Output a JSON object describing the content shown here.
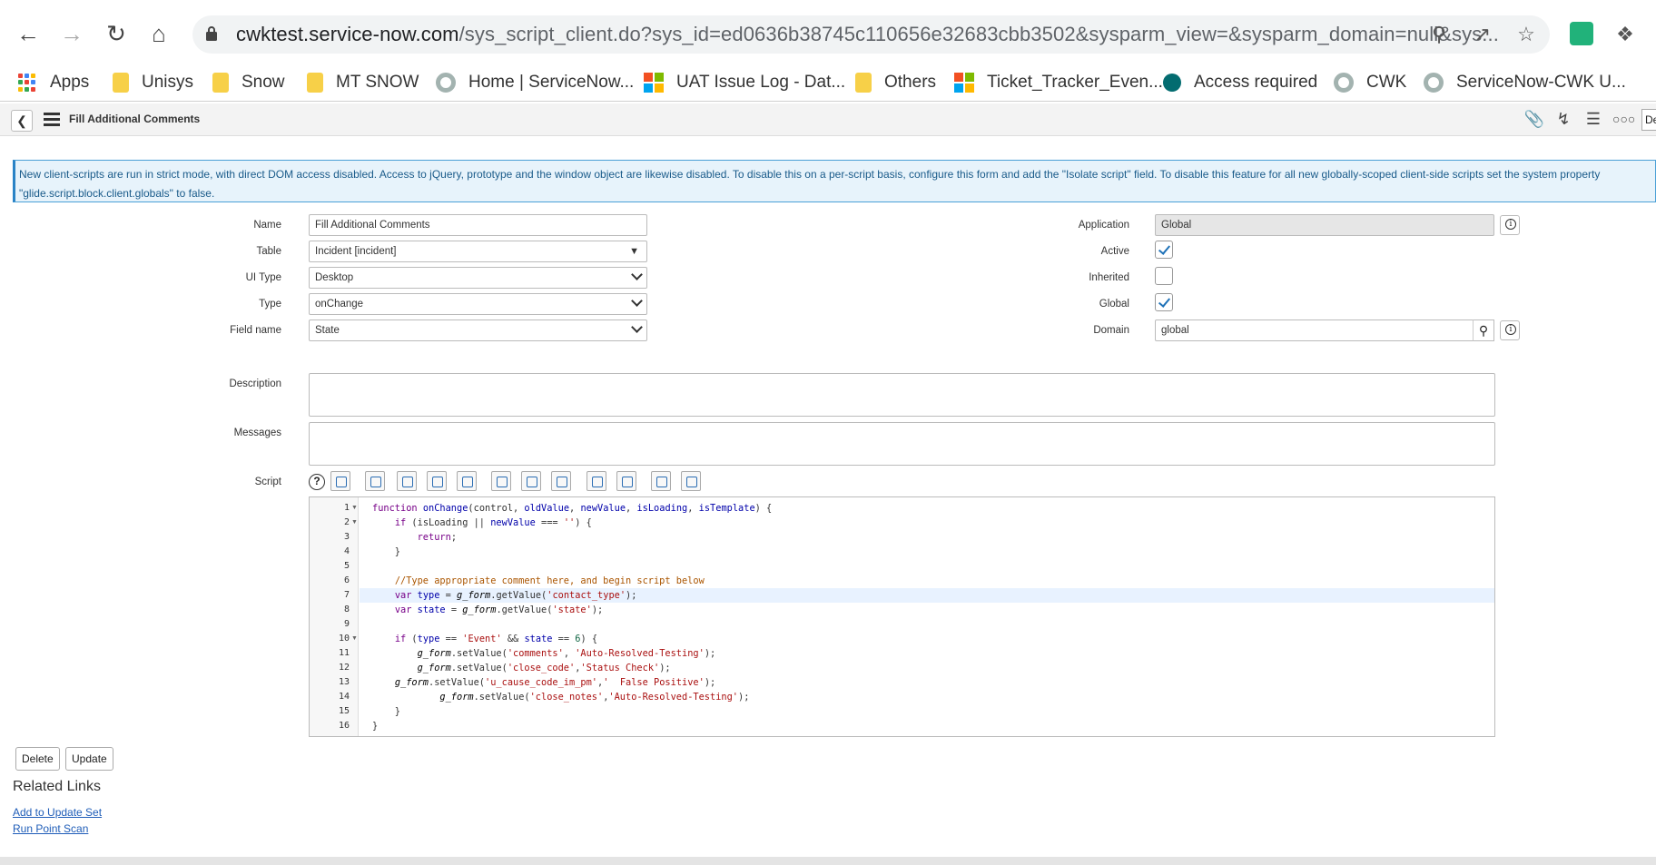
{
  "browser": {
    "url_host": "cwktest.service-now.com",
    "url_path": "/sys_script_client.do?sys_id=ed0636b38745c110656e32683cbb3502&sysparm_view=&sysparm_domain=null&sys...",
    "bookmarks": [
      {
        "label": "Apps",
        "icon": "apps-grid-icon"
      },
      {
        "label": "Unisys",
        "icon": "folder-icon"
      },
      {
        "label": "Snow",
        "icon": "folder-icon"
      },
      {
        "label": "MT SNOW",
        "icon": "folder-icon"
      },
      {
        "label": "Home | ServiceNow...",
        "icon": "servicenow-icon"
      },
      {
        "label": "UAT Issue Log - Dat...",
        "icon": "microsoft-icon"
      },
      {
        "label": "Others",
        "icon": "folder-icon"
      },
      {
        "label": "Ticket_Tracker_Even...",
        "icon": "microsoft-icon"
      },
      {
        "label": "Access required",
        "icon": "sharepoint-icon"
      },
      {
        "label": "CWK",
        "icon": "servicenow-icon"
      },
      {
        "label": "ServiceNow-CWK U...",
        "icon": "servicenow-icon"
      }
    ]
  },
  "header": {
    "title": "Fill Additional Comments",
    "de_label": "De"
  },
  "banner": {
    "text": "New client-scripts are run in strict mode, with direct DOM access disabled. Access to jQuery, prototype and the window object are likewise disabled. To disable this on a per-script basis, configure this form and add the \"Isolate script\" field. To disable this feature for all new globally-scoped client-side scripts set the system property \"glide.script.block.client.globals\" to false."
  },
  "form": {
    "name_label": "Name",
    "name_value": "Fill Additional Comments",
    "table_label": "Table",
    "table_value": "Incident [incident]",
    "uitype_label": "UI Type",
    "uitype_value": "Desktop",
    "type_label": "Type",
    "type_value": "onChange",
    "fieldname_label": "Field name",
    "fieldname_value": "State",
    "application_label": "Application",
    "application_value": "Global",
    "active_label": "Active",
    "active_checked": true,
    "inherited_label": "Inherited",
    "inherited_checked": false,
    "global_label": "Global",
    "global_checked": true,
    "domain_label": "Domain",
    "domain_value": "global",
    "description_label": "Description",
    "messages_label": "Messages",
    "script_label": "Script",
    "script_help": "?"
  },
  "script_lines": [
    "1",
    "2",
    "3",
    "4",
    "5",
    "6",
    "7",
    "8",
    "9",
    "10",
    "11",
    "12",
    "13",
    "14",
    "15",
    "16"
  ],
  "buttons": {
    "delete": "Delete",
    "update": "Update"
  },
  "related": {
    "title": "Related Links",
    "links": [
      "Add to Update Set",
      "Run Point Scan"
    ]
  }
}
